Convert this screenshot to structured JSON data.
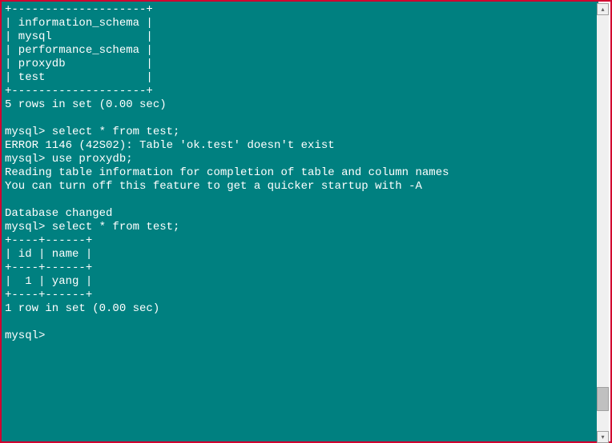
{
  "terminal": {
    "table_border_top": "+--------------------+",
    "databases": [
      "| information_schema |",
      "| mysql              |",
      "| performance_schema |",
      "| proxydb            |",
      "| test               |"
    ],
    "table_border_bottom": "+--------------------+",
    "rows_set": "5 rows in set (0.00 sec)",
    "blank1": "",
    "prompt1": "mysql> select * from test;",
    "error": "ERROR 1146 (42S02): Table 'ok.test' doesn't exist",
    "prompt2": "mysql> use proxydb;",
    "reading1": "Reading table information for completion of table and column names",
    "reading2": "You can turn off this feature to get a quicker startup with -A",
    "blank2": "",
    "dbchanged": "Database changed",
    "prompt3": "mysql> select * from test;",
    "table2_border": "+----+------+",
    "table2_header": "| id | name |",
    "table2_border2": "+----+------+",
    "table2_row": "|  1 | yang |",
    "table2_border3": "+----+------+",
    "rows_set2": "1 row in set (0.00 sec)",
    "blank3": "",
    "prompt4": "mysql>"
  },
  "scrollbar": {
    "up_arrow": "▴",
    "down_arrow": "▾"
  }
}
